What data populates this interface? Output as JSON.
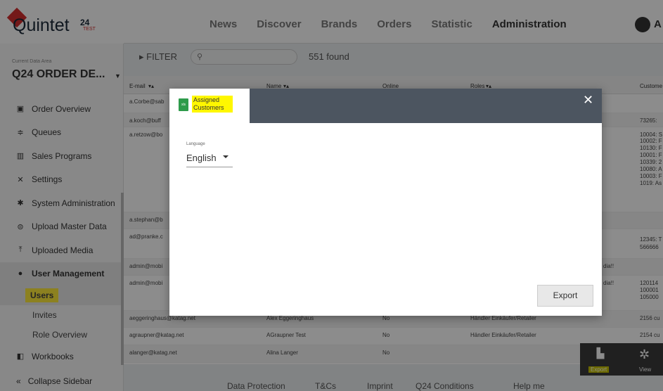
{
  "topbar": {
    "logo": "Quintet",
    "logo_sup": "24",
    "logo_test": "TEST",
    "nav": [
      "News",
      "Discover",
      "Brands",
      "Orders",
      "Statistic",
      "Administration"
    ],
    "user_initial": "A"
  },
  "sidebar": {
    "data_area_label": "Current Data Area",
    "data_area_value": "Q24 ORDER DE...",
    "items": [
      {
        "label": "Order Overview",
        "icon": "briefcase-icon"
      },
      {
        "label": "Queues",
        "icon": "queue-icon"
      },
      {
        "label": "Sales Programs",
        "icon": "sales-icon"
      },
      {
        "label": "Settings",
        "icon": "tools-icon"
      },
      {
        "label": "System Administration",
        "icon": "gear-icon"
      },
      {
        "label": "Upload Master Data",
        "icon": "upload-db-icon"
      },
      {
        "label": "Uploaded Media",
        "icon": "upload-icon"
      },
      {
        "label": "User Management",
        "icon": "user-icon"
      }
    ],
    "sub_items": [
      "Users",
      "Invites",
      "Role Overview"
    ],
    "workbooks": "Workbooks",
    "collapse": "Collapse Sidebar"
  },
  "filter": {
    "label": "FILTER",
    "found": "551 found"
  },
  "table": {
    "headers": [
      "E-mail",
      "Name",
      "Online",
      "Roles",
      "Custome"
    ],
    "rows": [
      {
        "email": "a.Corbe@sab",
        "name": "",
        "online": "",
        "roles": "",
        "cust": ""
      },
      {
        "email": "a.koch@buff",
        "name": "",
        "online": "",
        "roles": "",
        "cust": "73265: "
      },
      {
        "email": "a.retzow@bo",
        "name": "",
        "online": "",
        "roles": "",
        "cust": "10004: S"
      },
      {
        "email": "a.stephan@b",
        "name": "",
        "online": "",
        "roles": "",
        "cust": ""
      },
      {
        "email": "ad@pranke.c",
        "name": "",
        "online": "",
        "roles": "",
        "cust": "12345: T"
      },
      {
        "email": "admin@mobi",
        "name": "",
        "online": "",
        "roles": "dia!!",
        "cust": ""
      },
      {
        "email": "admin@mobi",
        "name": "",
        "online": "",
        "roles": "dia!!",
        "cust": "120114"
      },
      {
        "email": "aeggeringhaus@katag.net",
        "name": "Alex Eggeringhaus",
        "online": "No",
        "roles": "Händler Einkäufer/Retailer",
        "cust": "2156 cu"
      },
      {
        "email": "agraupner@katag.net",
        "name": "AGraupner Test",
        "online": "No",
        "roles": "Händler Einkäufer/Retailer",
        "cust": "2154 cu"
      },
      {
        "email": "alanger@katag.net",
        "name": "Alina Langer",
        "online": "No",
        "roles": "",
        "cust": ""
      }
    ],
    "extra_cust_lines": [
      "10002: F",
      "10130: F",
      "10001: F",
      "10339: 2",
      "10080: A",
      "10003: F",
      "1019: As"
    ],
    "extra_cust_5": "566666",
    "extra_cust_7": [
      "100001",
      "105000"
    ]
  },
  "footer": [
    "Data Protection",
    "T&Cs",
    "Imprint",
    "Q24 Conditions",
    "Help me"
  ],
  "tools": {
    "export": "Export",
    "view": "View"
  },
  "modal": {
    "tab_label": "Assigned Customers",
    "xls": "xls",
    "close": "✕",
    "language_label": "Language",
    "language_value": "English",
    "export_button": "Export"
  }
}
